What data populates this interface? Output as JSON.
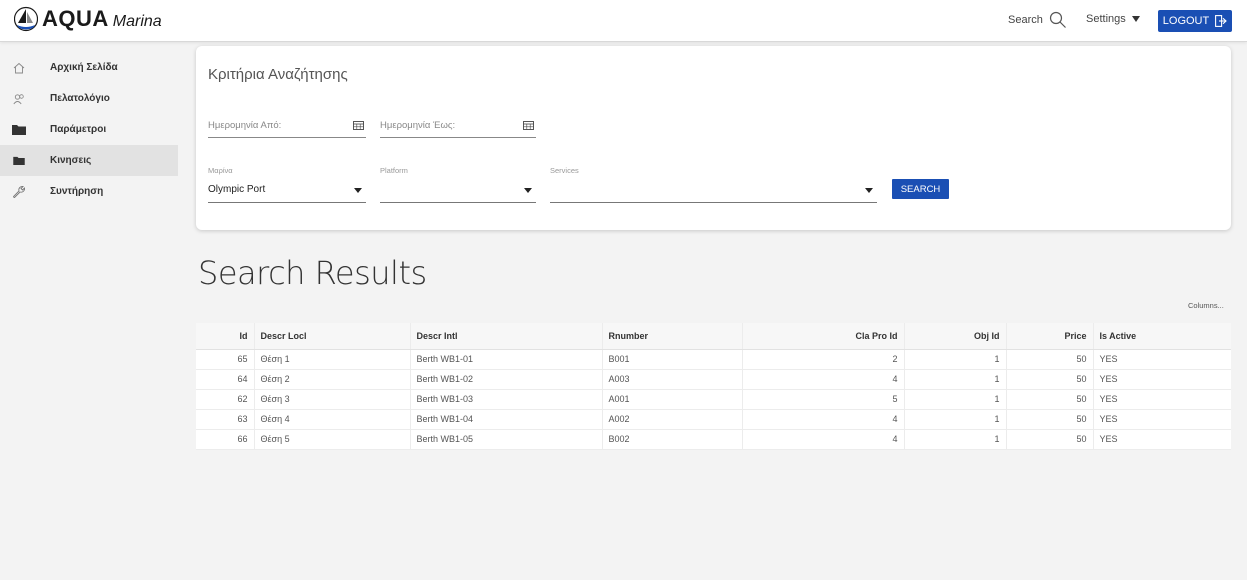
{
  "header": {
    "logo_main": "AQUA",
    "logo_sub": "Marina",
    "search_label": "Search",
    "settings_label": "Settings",
    "logout_label": "LOGOUT"
  },
  "sidebar": {
    "items": [
      {
        "label": "Αρχική Σελίδα",
        "icon": "home-icon"
      },
      {
        "label": "Πελατολόγιο",
        "icon": "customers-icon"
      },
      {
        "label": "Παράμετροι",
        "icon": "folder-icon"
      },
      {
        "label": "Κινησεις",
        "icon": "folder-icon"
      },
      {
        "label": "Συντήρηση",
        "icon": "wrench-icon"
      }
    ]
  },
  "criteria": {
    "title": "Κριτήρια Αναζήτησης",
    "date_from_placeholder": "Ημερομηνία Από:",
    "date_to_placeholder": "Ημερομηνία Έως:",
    "marina_label": "Μαρίνα",
    "marina_value": "Olympic Port",
    "platform_label": "Platform",
    "platform_value": "",
    "services_label": "Services",
    "services_value": "",
    "search_button": "SEARCH"
  },
  "results": {
    "title": "Search Results",
    "columns_link": "Columns...",
    "headers": [
      "Id",
      "Descr Locl",
      "Descr Intl",
      "Rnumber",
      "Cla Pro Id",
      "Obj Id",
      "Price",
      "Is Active"
    ],
    "rows": [
      [
        "65",
        "Θέση 1",
        "Berth WB1-01",
        "B001",
        "2",
        "1",
        "50",
        "YES"
      ],
      [
        "64",
        "Θέση 2",
        "Berth WB1-02",
        "A003",
        "4",
        "1",
        "50",
        "YES"
      ],
      [
        "62",
        "Θέση 3",
        "Berth WB1-03",
        "A001",
        "5",
        "1",
        "50",
        "YES"
      ],
      [
        "63",
        "Θέση 4",
        "Berth WB1-04",
        "A002",
        "4",
        "1",
        "50",
        "YES"
      ],
      [
        "66",
        "Θέση 5",
        "Berth WB1-05",
        "B002",
        "4",
        "1",
        "50",
        "YES"
      ]
    ]
  },
  "colors": {
    "accent": "#1a4fb4",
    "sidebar_active": "#e2e2e2",
    "background": "#f3f3f3"
  }
}
